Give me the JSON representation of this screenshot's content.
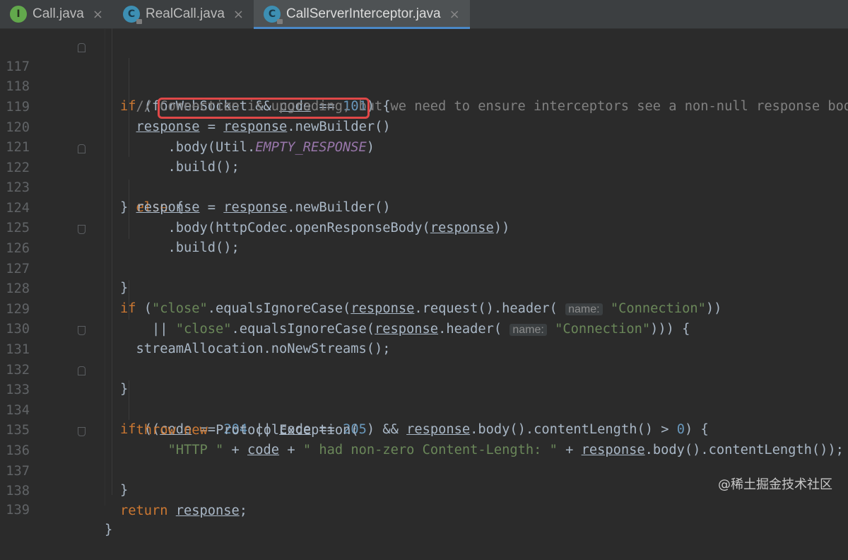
{
  "tabs": [
    {
      "label": "Call.java",
      "icon": "interface-icon",
      "glyph": "I"
    },
    {
      "label": "RealCall.java",
      "icon": "class-icon",
      "glyph": "C"
    },
    {
      "label": "CallServerInterceptor.java",
      "icon": "class-icon",
      "glyph": "C",
      "active": true
    }
  ],
  "tab_close_glyph": "×",
  "lines": {
    "117": {
      "num": "117"
    },
    "118": {
      "num": "118"
    },
    "119": {
      "num": "119"
    },
    "120": {
      "num": "120"
    },
    "121": {
      "num": "121"
    },
    "122": {
      "num": "122"
    },
    "123": {
      "num": "123"
    },
    "124": {
      "num": "124"
    },
    "125": {
      "num": "125"
    },
    "126": {
      "num": "126"
    },
    "127": {
      "num": "127"
    },
    "128": {
      "num": "128"
    },
    "129": {
      "num": "129"
    },
    "130": {
      "num": "130"
    },
    "131": {
      "num": "131"
    },
    "132": {
      "num": "132"
    },
    "133": {
      "num": "133"
    },
    "134": {
      "num": "134"
    },
    "135": {
      "num": "135"
    },
    "136": {
      "num": "136"
    },
    "137": {
      "num": "137"
    },
    "138": {
      "num": "138"
    },
    "139": {
      "num": "139"
    }
  },
  "code": {
    "l117": [
      "if",
      " (",
      "forWebSocket",
      " && ",
      "code",
      " == ",
      "101",
      ") {"
    ],
    "l118": [
      "  // Connection is upgrading, but we need to ensure interceptors see a non-null response body."
    ],
    "l119": [
      "  ",
      "response",
      " = ",
      "response",
      ".newBuilder()"
    ],
    "l120": [
      "      .body(Util.",
      "EMPTY_RESPONSE",
      ")"
    ],
    "l121": [
      "      .build();"
    ],
    "l122": [
      "} ",
      "else",
      " {"
    ],
    "l123": [
      "  ",
      "response",
      " = ",
      "response",
      ".newBuilder()"
    ],
    "l124": [
      "      .body(httpCodec.openResponseBody(",
      "response",
      "))"
    ],
    "l125": [
      "      .build();"
    ],
    "l126": [
      "}"
    ],
    "l128": [
      "if",
      " (",
      "\"close\"",
      ".equalsIgnoreCase(",
      "response",
      ".request().header( ",
      "name:",
      " ",
      "\"Connection\"",
      "))"
    ],
    "l129": [
      "    || ",
      "\"close\"",
      ".equalsIgnoreCase(",
      "response",
      ".header( ",
      "name:",
      " ",
      "\"Connection\"",
      "))) {"
    ],
    "l130": [
      "  streamAllocation.noNewStreams();"
    ],
    "l131": [
      "}"
    ],
    "l133": [
      "if",
      " ((",
      "code",
      " == ",
      "204",
      " || ",
      "code",
      " == ",
      "205",
      ") && ",
      "response",
      ".body().contentLength() > ",
      "0",
      ") {"
    ],
    "l134": [
      "  ",
      "throw",
      " ",
      "new",
      " ProtocolException("
    ],
    "l135": [
      "      ",
      "\"HTTP \"",
      " + ",
      "code",
      " + ",
      "\" had non-zero Content-Length: \"",
      " + ",
      "response",
      ".body().contentLength());"
    ],
    "l136": [
      "}"
    ],
    "l138": [
      "return",
      " ",
      "response",
      ";"
    ],
    "l139": [
      "}"
    ]
  },
  "watermark": "@稀土掘金技术社区",
  "colors": {
    "background": "#2b2b2b",
    "keyword": "#cc7832",
    "number": "#6897bb",
    "string": "#6a8759",
    "comment": "#808080",
    "static_field": "#9876aa",
    "highlight_box": "#e04848",
    "active_tab_underline": "#4a88c7"
  }
}
